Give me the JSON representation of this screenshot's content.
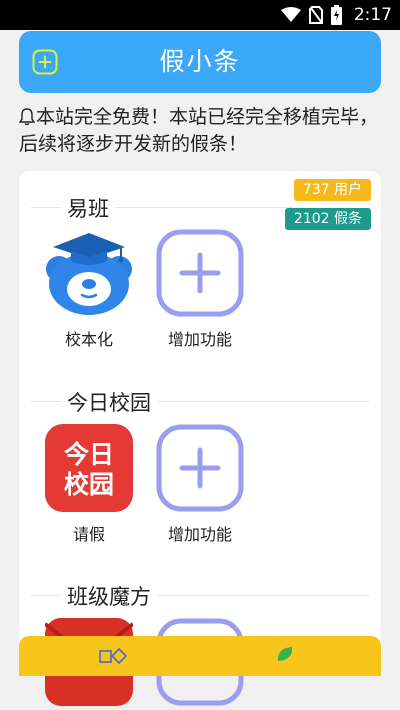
{
  "status_bar": {
    "time": "2:17"
  },
  "header": {
    "title": "假小条"
  },
  "notice": {
    "text": "本站完全免费！本站已经完全移植完毕，后续将逐步开发新的假条！"
  },
  "sections": [
    {
      "title": "易班",
      "tiles": [
        {
          "label": "校本化"
        },
        {
          "label": "增加功能"
        }
      ]
    },
    {
      "title": "今日校园",
      "tiles": [
        {
          "label": "请假",
          "logo_text": [
            "今日",
            "校园"
          ]
        },
        {
          "label": "增加功能"
        }
      ]
    },
    {
      "title": "班级魔方",
      "tiles": [
        {
          "label": ""
        },
        {
          "label": ""
        }
      ]
    }
  ],
  "badges": {
    "users": "737 用户",
    "posts": "2102 假条"
  },
  "colors": {
    "header": "#3aa7f7",
    "accent_yellow": "#f6b91b",
    "accent_teal": "#1c9b8c",
    "add_tile_stroke": "#9b9ef0",
    "bottom_bar": "#f8c51a",
    "today_campus_red": "#e53935"
  }
}
